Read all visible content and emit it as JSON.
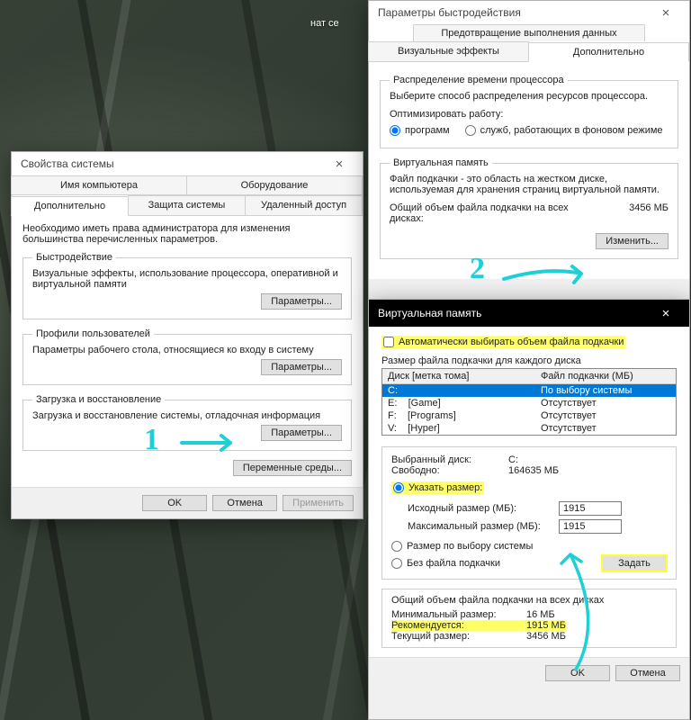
{
  "desktop": {
    "cloud_text": "нат\nсе"
  },
  "sysprops": {
    "title": "Свойства системы",
    "tabs_row1": [
      "Имя компьютера",
      "Оборудование"
    ],
    "tabs_row2": [
      "Дополнительно",
      "Защита системы",
      "Удаленный доступ"
    ],
    "active_tab": "Дополнительно",
    "note": "Необходимо иметь права администратора для изменения большинства перечисленных параметров.",
    "perf": {
      "legend": "Быстродействие",
      "text": "Визуальные эффекты, использование процессора, оперативной и виртуальной памяти",
      "button": "Параметры..."
    },
    "profiles": {
      "legend": "Профили пользователей",
      "text": "Параметры рабочего стола, относящиеся ко входу в систему",
      "button": "Параметры..."
    },
    "boot": {
      "legend": "Загрузка и восстановление",
      "text": "Загрузка и восстановление системы, отладочная информация",
      "button": "Параметры..."
    },
    "envvars_button": "Переменные среды...",
    "ok": "OK",
    "cancel": "Отмена",
    "apply": "Применить"
  },
  "perfopts": {
    "title": "Параметры быстродействия",
    "tab_top": "Предотвращение выполнения данных",
    "tab_left": "Визуальные эффекты",
    "tab_right": "Дополнительно",
    "sched": {
      "legend": "Распределение времени процессора",
      "text": "Выберите способ распределения ресурсов процессора.",
      "opt_label": "Оптимизировать работу:",
      "opt1": "программ",
      "opt2": "служб, работающих в фоновом режиме"
    },
    "vm": {
      "legend": "Виртуальная память",
      "text": "Файл подкачки - это область на жестком диске, используемая для хранения страниц виртуальной памяти.",
      "total_label": "Общий объем файла подкачки на всех дисках:",
      "total_value": "3456 МБ",
      "change": "Изменить..."
    }
  },
  "vmdlg": {
    "title": "Виртуальная память",
    "auto_chk": "Автоматически выбирать объем файла подкачки",
    "each_label": "Размер файла подкачки для каждого диска",
    "col_disk": "Диск [метка тома]",
    "col_pf": "Файл подкачки (МБ)",
    "drives": [
      {
        "d": "C:",
        "label": "",
        "pf": "По выбору системы",
        "sel": true
      },
      {
        "d": "E:",
        "label": "[Game]",
        "pf": "Отсутствует",
        "sel": false
      },
      {
        "d": "F:",
        "label": "[Programs]",
        "pf": "Отсутствует",
        "sel": false
      },
      {
        "d": "V:",
        "label": "[Hyper]",
        "pf": "Отсутствует",
        "sel": false
      }
    ],
    "sel_drive_label": "Выбранный диск:",
    "sel_drive_value": "C:",
    "free_label": "Свободно:",
    "free_value": "164635 МБ",
    "opt_custom": "Указать размер:",
    "init_label": "Исходный размер (МБ):",
    "init_value": "1915",
    "max_label": "Максимальный размер (МБ):",
    "max_value": "1915",
    "opt_sys": "Размер по выбору системы",
    "opt_none": "Без файла подкачки",
    "set": "Задать",
    "totals": {
      "legend": "Общий объем файла подкачки на всех дисках",
      "min_label": "Минимальный размер:",
      "min_value": "16 МБ",
      "rec_label": "Рекомендуется:",
      "rec_value": "1915 МБ",
      "cur_label": "Текущий размер:",
      "cur_value": "3456 МБ"
    },
    "ok": "OK",
    "cancel": "Отмена"
  },
  "annot": {
    "one": "1",
    "two": "2"
  }
}
